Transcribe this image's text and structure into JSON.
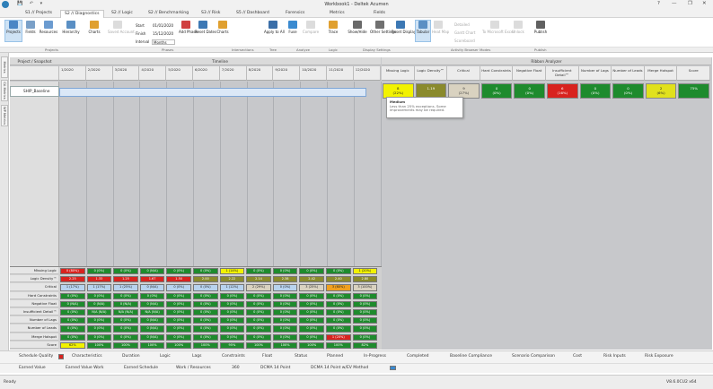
{
  "window": {
    "title": "Workbook1 - Deltek Acumen",
    "quick_access": "💾 ↶ ▾",
    "help": "?",
    "minimize": "—",
    "restore": "❐",
    "close": "✕"
  },
  "tabs": [
    {
      "label": "S1 // Projects"
    },
    {
      "label": "S2 // Diagnostics",
      "active": true
    },
    {
      "label": "S2 // Logic"
    },
    {
      "label": "S2 // Benchmarking"
    },
    {
      "label": "S3 // Risk"
    },
    {
      "label": "S5 // Dashboard"
    },
    {
      "label": "Forensics"
    },
    {
      "label": "Metrics"
    },
    {
      "label": "Fields"
    }
  ],
  "ribbon": {
    "projects": "Projects",
    "fields": "Fields",
    "resources": "Resources",
    "hierarchy": "Hierarchy",
    "charts": "Charts",
    "saved_account": "Saved Account",
    "start_label": "Start",
    "start_value": "01/01/2020",
    "finish_label": "Finish",
    "finish_value": "15/12/2020",
    "interval_label": "Interval",
    "interval_value": "Months",
    "add_phase": "Add Phase",
    "reset_dates": "Reset Dates",
    "charts2": "Charts",
    "apply_to_all": "Apply to All",
    "fuse": "Fuse",
    "compare": "Compare",
    "trace": "Trace",
    "show_hide": "Show/Hide",
    "other_settings": "Other Settings",
    "reset_display": "Reset Display",
    "tabular": "Tabular",
    "heat_map": "Heat Map",
    "detailed": "Detailed",
    "gantt_chart": "Gantt Chart",
    "scoreboard": "Scoreboard",
    "to_microsoft_excel": "To Microsoft Excel",
    "unlock": "Unlock",
    "publish": "Publish",
    "group_labels": {
      "projects": "Projects",
      "phases": "Phases",
      "intersections": "Intersections",
      "tree": "Tree",
      "analyze": "Analyze",
      "logic": "Logic",
      "display_settings": "Display Settings",
      "activity_browser_modes": "Activity Browser Modes",
      "publish": "Publish"
    }
  },
  "side_tabs": [
    "Metrics",
    "CA Metrics",
    "WP Metrics"
  ],
  "headers": {
    "project_snapshot": "Project / Snapshot",
    "timeline": "Timeline",
    "ribbon_analyzer": "Ribbon Analyzer"
  },
  "months": [
    "1/2020",
    "2/2020",
    "3/2020",
    "4/2020",
    "5/2020",
    "6/2020",
    "7/2020",
    "8/2020",
    "9/2020",
    "10/2020",
    "11/2020",
    "12/2020"
  ],
  "snapshot": {
    "name": "SHIP_Baseline"
  },
  "analyzer_columns": [
    "Missing Logic",
    "Logic Density™",
    "Critical",
    "Hard Constraints",
    "Negative Float",
    "Insufficient Detail™",
    "Number of Lags",
    "Number of Leads",
    "Merge Hotspot",
    "Score"
  ],
  "analyzer_row": [
    {
      "main": "8",
      "sub": "(22%)",
      "color": "#f2f200",
      "fg": "#222"
    },
    {
      "main": "1.19",
      "sub": "",
      "color": "#8a8a2c",
      "fg": "#fff"
    },
    {
      "main": "9",
      "sub": "(27%)",
      "color": "#d9d2c0",
      "fg": "#333"
    },
    {
      "main": "0",
      "sub": "(0%)",
      "color": "#1e8b2d",
      "fg": "#fff"
    },
    {
      "main": "0",
      "sub": "(0%)",
      "color": "#1e8b2d",
      "fg": "#fff"
    },
    {
      "main": "6",
      "sub": "(16%)",
      "color": "#d8231f",
      "fg": "#fff"
    },
    {
      "main": "0",
      "sub": "(0%)",
      "color": "#1e8b2d",
      "fg": "#fff"
    },
    {
      "main": "0",
      "sub": "(0%)",
      "color": "#1e8b2d",
      "fg": "#fff"
    },
    {
      "main": "2",
      "sub": "(6%)",
      "color": "#e1e11c",
      "fg": "#222"
    },
    {
      "main": "75%",
      "sub": "",
      "color": "#1e8b2d",
      "fg": "#fff"
    }
  ],
  "tooltip": {
    "title": "Medium",
    "body": "Less than 25% exceptions. Some improvements may be required."
  },
  "metric_rows": [
    "Missing Logic",
    "Logic Density™",
    "Critical",
    "Hard Constraints",
    "Negative Float",
    "Insufficient Detail™",
    "Number of Lags",
    "Number of Leads",
    "Merge Hotspot",
    "Score"
  ],
  "metric_values": [
    [
      [
        "0 (80%)",
        "#d8231f"
      ],
      [
        "0 (0%)",
        "#1e8b2d"
      ],
      [
        "0 (0%)",
        "#1e8b2d"
      ],
      [
        "0 (N/A)",
        "#1e8b2d"
      ],
      [
        "0 (0%)",
        "#1e8b2d"
      ],
      [
        "0 (0%)",
        "#1e8b2d"
      ],
      [
        "1 (14%)",
        "#f2f200"
      ],
      [
        "0 (0%)",
        "#1e8b2d"
      ],
      [
        "0 (0%)",
        "#1e8b2d"
      ],
      [
        "0 (0%)",
        "#1e8b2d"
      ],
      [
        "0 (0%)",
        "#1e8b2d"
      ],
      [
        "1 (20%)",
        "#f2f200"
      ]
    ],
    [
      [
        "2.25",
        "#d8231f"
      ],
      [
        "1.33",
        "#d8231f"
      ],
      [
        "1.25",
        "#d8231f"
      ],
      [
        "1.67",
        "#d8231f"
      ],
      [
        "1.50",
        "#d8231f"
      ],
      [
        "2.00",
        "#8a8a2c"
      ],
      [
        "2.22",
        "#8a8a2c"
      ],
      [
        "2.14",
        "#8a8a2c"
      ],
      [
        "2.38",
        "#8a8a2c"
      ],
      [
        "2.42",
        "#8a8a2c"
      ],
      [
        "2.40",
        "#8a8a2c"
      ],
      [
        "2.80",
        "#8a8a2c"
      ]
    ],
    [
      [
        "1 (17%)",
        "#b8d3ee"
      ],
      [
        "1 (17%)",
        "#b8d3ee"
      ],
      [
        "1 (25%)",
        "#b8d3ee"
      ],
      [
        "0 (N/A)",
        "#b8d3ee"
      ],
      [
        "0 (0%)",
        "#b8d3ee"
      ],
      [
        "0 (0%)",
        "#b8d3ee"
      ],
      [
        "1 (12%)",
        "#b8d3ee"
      ],
      [
        "2 (29%)",
        "#d9d2c0"
      ],
      [
        "0 (0%)",
        "#b8d3ee"
      ],
      [
        "3 (25%)",
        "#d9d2c0"
      ],
      [
        "3 (60%)",
        "#f0a020"
      ],
      [
        "3 (100%)",
        "#d9d2c0"
      ]
    ],
    [
      [
        "0 (0%)",
        "#1e8b2d"
      ],
      [
        "0 (0%)",
        "#1e8b2d"
      ],
      [
        "0 (0%)",
        "#1e8b2d"
      ],
      [
        "0 (0%)",
        "#1e8b2d"
      ],
      [
        "0 (0%)",
        "#1e8b2d"
      ],
      [
        "0 (0%)",
        "#1e8b2d"
      ],
      [
        "0 (0%)",
        "#1e8b2d"
      ],
      [
        "0 (0%)",
        "#1e8b2d"
      ],
      [
        "0 (0%)",
        "#1e8b2d"
      ],
      [
        "0 (0%)",
        "#1e8b2d"
      ],
      [
        "0 (0%)",
        "#1e8b2d"
      ],
      [
        "0 (0%)",
        "#1e8b2d"
      ]
    ],
    [
      [
        "0 (N/A)",
        "#1e8b2d"
      ],
      [
        "0 (N/A)",
        "#1e8b2d"
      ],
      [
        "0 (N/A)",
        "#1e8b2d"
      ],
      [
        "0 (N/A)",
        "#1e8b2d"
      ],
      [
        "0 (0%)",
        "#1e8b2d"
      ],
      [
        "0 (0%)",
        "#1e8b2d"
      ],
      [
        "0 (0%)",
        "#1e8b2d"
      ],
      [
        "0 (0%)",
        "#1e8b2d"
      ],
      [
        "0 (0%)",
        "#1e8b2d"
      ],
      [
        "0 (0%)",
        "#1e8b2d"
      ],
      [
        "0 (0%)",
        "#1e8b2d"
      ],
      [
        "0 (0%)",
        "#1e8b2d"
      ]
    ],
    [
      [
        "0 (0%)",
        "#1e8b2d"
      ],
      [
        "N/A (N/A)",
        "#1e8b2d"
      ],
      [
        "N/A (N/A)",
        "#1e8b2d"
      ],
      [
        "N/A (N/A)",
        "#1e8b2d"
      ],
      [
        "0 (0%)",
        "#1e8b2d"
      ],
      [
        "0 (0%)",
        "#1e8b2d"
      ],
      [
        "0 (0%)",
        "#1e8b2d"
      ],
      [
        "0 (0%)",
        "#1e8b2d"
      ],
      [
        "0 (0%)",
        "#1e8b2d"
      ],
      [
        "0 (0%)",
        "#1e8b2d"
      ],
      [
        "0 (0%)",
        "#1e8b2d"
      ],
      [
        "0 (0%)",
        "#1e8b2d"
      ]
    ],
    [
      [
        "0 (0%)",
        "#1e8b2d"
      ],
      [
        "0 (0%)",
        "#1e8b2d"
      ],
      [
        "0 (0%)",
        "#1e8b2d"
      ],
      [
        "0 (N/A)",
        "#1e8b2d"
      ],
      [
        "0 (0%)",
        "#1e8b2d"
      ],
      [
        "0 (0%)",
        "#1e8b2d"
      ],
      [
        "0 (0%)",
        "#1e8b2d"
      ],
      [
        "0 (0%)",
        "#1e8b2d"
      ],
      [
        "0 (0%)",
        "#1e8b2d"
      ],
      [
        "0 (0%)",
        "#1e8b2d"
      ],
      [
        "0 (0%)",
        "#1e8b2d"
      ],
      [
        "0 (0%)",
        "#1e8b2d"
      ]
    ],
    [
      [
        "0 (0%)",
        "#1e8b2d"
      ],
      [
        "0 (0%)",
        "#1e8b2d"
      ],
      [
        "0 (0%)",
        "#1e8b2d"
      ],
      [
        "0 (N/A)",
        "#1e8b2d"
      ],
      [
        "0 (0%)",
        "#1e8b2d"
      ],
      [
        "0 (0%)",
        "#1e8b2d"
      ],
      [
        "0 (0%)",
        "#1e8b2d"
      ],
      [
        "0 (0%)",
        "#1e8b2d"
      ],
      [
        "0 (0%)",
        "#1e8b2d"
      ],
      [
        "0 (0%)",
        "#1e8b2d"
      ],
      [
        "0 (0%)",
        "#1e8b2d"
      ],
      [
        "0 (0%)",
        "#1e8b2d"
      ]
    ],
    [
      [
        "0 (0%)",
        "#1e8b2d"
      ],
      [
        "0 (0%)",
        "#1e8b2d"
      ],
      [
        "0 (0%)",
        "#1e8b2d"
      ],
      [
        "0 (N/A)",
        "#1e8b2d"
      ],
      [
        "0 (0%)",
        "#1e8b2d"
      ],
      [
        "0 (0%)",
        "#1e8b2d"
      ],
      [
        "0 (0%)",
        "#1e8b2d"
      ],
      [
        "0 (0%)",
        "#1e8b2d"
      ],
      [
        "0 (0%)",
        "#1e8b2d"
      ],
      [
        "0 (0%)",
        "#1e8b2d"
      ],
      [
        "1 (20%)",
        "#d8231f"
      ],
      [
        "0 (0%)",
        "#1e8b2d"
      ]
    ],
    [
      [
        "62%",
        "#f2f200"
      ],
      [
        "100%",
        "#1e8b2d"
      ],
      [
        "100%",
        "#1e8b2d"
      ],
      [
        "100%",
        "#1e8b2d"
      ],
      [
        "100%",
        "#1e8b2d"
      ],
      [
        "100%",
        "#1e8b2d"
      ],
      [
        "95%",
        "#1e8b2d"
      ],
      [
        "100%",
        "#1e8b2d"
      ],
      [
        "100%",
        "#1e8b2d"
      ],
      [
        "100%",
        "#1e8b2d"
      ],
      [
        "100%",
        "#1e8b2d"
      ],
      [
        "82%",
        "#1e8b2d"
      ]
    ]
  ],
  "bottom_tabs_1": [
    "Schedule Quality",
    "Characteristics",
    "Duration",
    "Logic",
    "Lags",
    "Constraints",
    "Float",
    "Status",
    "Planned",
    "In-Progress",
    "Completed",
    "Baseline Compliance",
    "Scenario Comparison",
    "Cost",
    "Risk Inputs",
    "Risk Exposure"
  ],
  "bottom_tabs_2": [
    "Earned Value",
    "Earned Value Work",
    "Earned Schedule",
    "Work / Resources",
    "360",
    "DCMA 14 Point",
    "DCMA 14 Point w/EV Method"
  ],
  "status": {
    "left": "Ready",
    "right": "V8.6.0CU2 x64"
  },
  "colors": {
    "green": "#1e8b2d",
    "red": "#d8231f",
    "yellow": "#f2f200",
    "olive": "#8a8a2c",
    "blue_light": "#b8d3ee"
  }
}
